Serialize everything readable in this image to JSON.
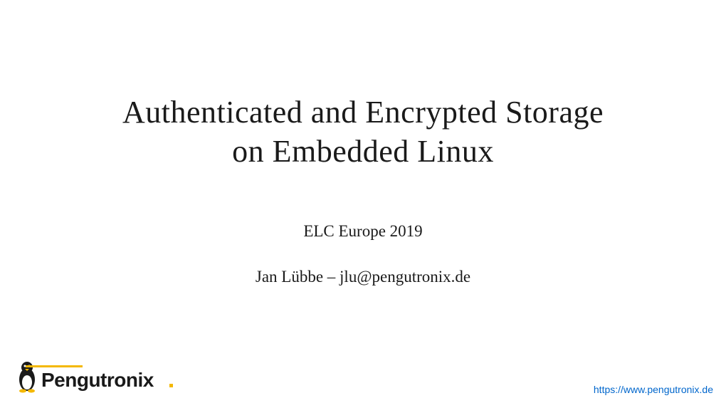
{
  "title_line1": "Authenticated and Encrypted Storage",
  "title_line2": "on Embedded Linux",
  "subtitle": "ELC Europe 2019",
  "author": "Jan Lübbe – jlu@pengutronix.de",
  "logo_text": "Pengutronix",
  "footer_url": "https://www.pengutronix.de"
}
